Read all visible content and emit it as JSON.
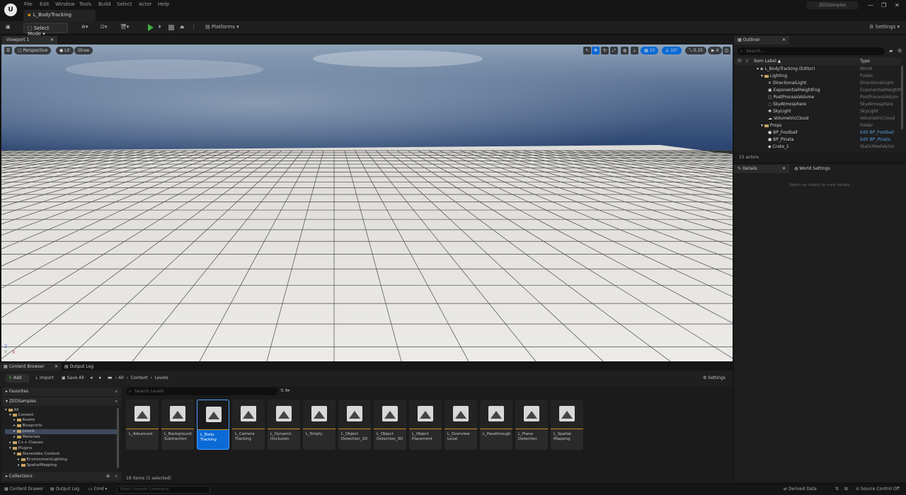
{
  "title_bar": {
    "menus": [
      "File",
      "Edit",
      "Window",
      "Tools",
      "Build",
      "Select",
      "Actor",
      "Help"
    ],
    "level_tab": "L_BodyTracking",
    "project_name": "ZEDSamples"
  },
  "toolbar": {
    "select_mode": "Select Mode",
    "platforms": "Platforms",
    "settings": "Settings"
  },
  "viewport": {
    "tab": "Viewport 1",
    "perspective": "Perspective",
    "lit": "Lit",
    "show": "Show",
    "grid_snap": "10",
    "rot_snap": "10°",
    "scale_snap": "0.25",
    "camera_speed": "4"
  },
  "outliner": {
    "tab": "Outliner",
    "search_placeholder": "Search...",
    "col_label": "Item Label ▲",
    "col_type": "Type",
    "rows": [
      {
        "name": "L_BodyTracking (Editor)",
        "type": "World"
      },
      {
        "name": "Lighting",
        "type": "Folder"
      },
      {
        "name": "DirectionalLight",
        "type": "DirectionalLight"
      },
      {
        "name": "ExponentialHeightFog",
        "type": "ExponentialHeightF"
      },
      {
        "name": "PostProcessVolume",
        "type": "PostProcessVolum"
      },
      {
        "name": "SkyAtmosphere",
        "type": "SkyAtmosphere"
      },
      {
        "name": "SkyLight",
        "type": "SkyLight"
      },
      {
        "name": "VolumetricCloud",
        "type": "VolumetricCloud"
      },
      {
        "name": "Props",
        "type": "Folder"
      },
      {
        "name": "BP_Football",
        "type": "Edit BP_Football"
      },
      {
        "name": "BP_Pinata",
        "type": "Edit BP_Pinata"
      },
      {
        "name": "Crate_1",
        "type": "StaticMeshActor"
      }
    ],
    "actor_count": "15 actors"
  },
  "details": {
    "tab": "Details",
    "world_settings_tab": "World Settings",
    "empty_message": "Select an object to view details."
  },
  "content_browser": {
    "tab": "Content Browser",
    "output_log_tab": "Output Log",
    "add": "Add",
    "import": "Import",
    "save_all": "Save All",
    "breadcrumb": [
      "All",
      "Content",
      "Levels"
    ],
    "settings": "Settings",
    "favorites": "Favorites",
    "project": "ZEDSamples",
    "search_placeholder": "Search Levels",
    "tree": [
      "All",
      "Content",
      "Assets",
      "Blueprints",
      "Levels",
      "Materials",
      "C++ Classes",
      "Plugins",
      "Stereolabs Content",
      "EnvironmentLighting",
      "SpatialMapping"
    ],
    "collections": "Collections",
    "item_count": "18 items (1 selected)",
    "assets": [
      "L_Advanced",
      "L_Background Subtraction",
      "L_Body Tracking",
      "L_Camera Tracking",
      "L_Dynamic Occlusion",
      "L_Empty",
      "L_Object Detection_2D",
      "L_Object Detection_3D",
      "L_Object Placement",
      "L_Overview Level",
      "L_Passthrough",
      "L_Plane Detection",
      "L_Spatial Mapping"
    ]
  },
  "status_bar": {
    "content_drawer": "Content Drawer",
    "output_log": "Output Log",
    "cmd": "Cmd",
    "cmd_placeholder": "Enter Console Command",
    "derived_data": "Derived Data",
    "source_control": "Source Control Off"
  },
  "colors": {
    "accent_blue": "#0a6ad6",
    "play_green": "#3fb03f",
    "asset_underline": "#c88818"
  }
}
